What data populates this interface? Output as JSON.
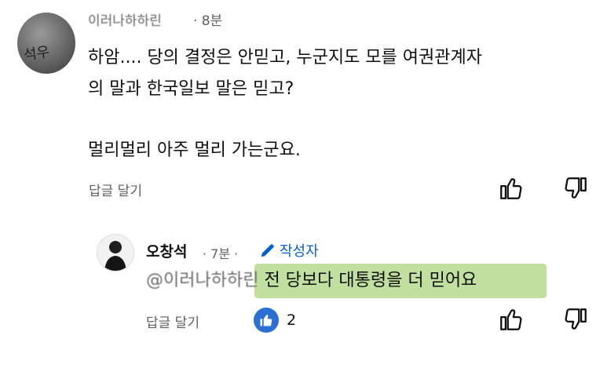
{
  "comment": {
    "author": "이러나하하린",
    "time": "· 8분",
    "lines": [
      "하암.... 당의 결정은 안믿고, 누군지도 모를 여권관계자",
      "의 말과 한국일보 말은 믿고?",
      "멀리멀리 아주 멀리 가는군요."
    ],
    "reply_label": "답글 달기"
  },
  "reply": {
    "author": "오창석",
    "time": "· 7분 ·",
    "creator_label": "작성자",
    "mention": "@이러나하하린",
    "text": " 전 당보다 대통령을 더 믿어요",
    "reply_label": "답글 달기",
    "like_count": "2"
  },
  "colors": {
    "highlight": "#b6d98e",
    "creator_blue": "#065fd4",
    "like_blue": "#2a6fd6"
  }
}
